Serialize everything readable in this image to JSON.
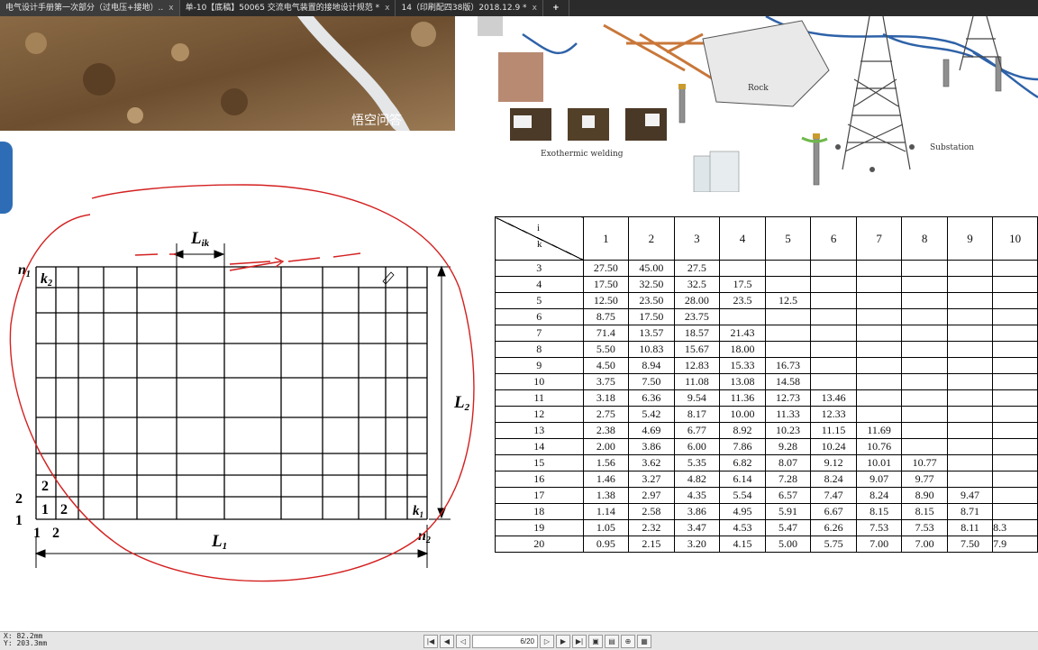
{
  "tabs": [
    {
      "label": "电气设计手册第一次部分（过电压+接地）.."
    },
    {
      "label": "单-10【底稿】50065 交流电气装置的接地设计规范 *"
    },
    {
      "label": "14（印刷配四38版）2018.12.9 *"
    }
  ],
  "tab_close": "x",
  "tab_add": "+",
  "photo": {
    "watermark": "悟空问答"
  },
  "infographic": {
    "label_rock": "Rock",
    "label_welding": "Exothermic welding",
    "label_substation": "Substation"
  },
  "figure": {
    "label_L_ik": "L",
    "label_L_ik_sub": "ik",
    "label_n1": "n",
    "label_n1_sub": "1",
    "label_k2": "k",
    "label_k2_sub": "2",
    "label_L2": "L",
    "label_L2_sub": "2",
    "label_L1": "L",
    "label_L1_sub": "1",
    "label_n2": "n",
    "label_n2_sub": "2",
    "label_k1": "k",
    "label_k1_sub": "1",
    "row_2": "2",
    "row_1": "1",
    "cell_2": "2",
    "cell_1": "1",
    "cell_1b": "1",
    "cell_2b": "2",
    "bottom_1": "1",
    "bottom_2": "2"
  },
  "table": {
    "corner_i": "i",
    "corner_k": "k",
    "columns": [
      "1",
      "2",
      "3",
      "4",
      "5",
      "6",
      "7",
      "8",
      "9",
      "10"
    ],
    "rows": [
      {
        "k": "3",
        "vals": [
          "27.50",
          "45.00",
          "27.5",
          "",
          "",
          "",
          "",
          "",
          "",
          ""
        ]
      },
      {
        "k": "4",
        "vals": [
          "17.50",
          "32.50",
          "32.5",
          "17.5",
          "",
          "",
          "",
          "",
          "",
          ""
        ]
      },
      {
        "k": "5",
        "vals": [
          "12.50",
          "23.50",
          "28.00",
          "23.5",
          "12.5",
          "",
          "",
          "",
          "",
          ""
        ]
      },
      {
        "k": "6",
        "vals": [
          "8.75",
          "17.50",
          "23.75",
          "",
          "",
          "",
          "",
          "",
          "",
          ""
        ]
      },
      {
        "k": "7",
        "vals": [
          "71.4",
          "13.57",
          "18.57",
          "21.43",
          "",
          "",
          "",
          "",
          "",
          ""
        ]
      },
      {
        "k": "8",
        "vals": [
          "5.50",
          "10.83",
          "15.67",
          "18.00",
          "",
          "",
          "",
          "",
          "",
          ""
        ]
      },
      {
        "k": "9",
        "vals": [
          "4.50",
          "8.94",
          "12.83",
          "15.33",
          "16.73",
          "",
          "",
          "",
          "",
          ""
        ]
      },
      {
        "k": "10",
        "vals": [
          "3.75",
          "7.50",
          "11.08",
          "13.08",
          "14.58",
          "",
          "",
          "",
          "",
          ""
        ]
      },
      {
        "k": "11",
        "vals": [
          "3.18",
          "6.36",
          "9.54",
          "11.36",
          "12.73",
          "13.46",
          "",
          "",
          "",
          ""
        ]
      },
      {
        "k": "12",
        "vals": [
          "2.75",
          "5.42",
          "8.17",
          "10.00",
          "11.33",
          "12.33",
          "",
          "",
          "",
          ""
        ]
      },
      {
        "k": "13",
        "vals": [
          "2.38",
          "4.69",
          "6.77",
          "8.92",
          "10.23",
          "11.15",
          "11.69",
          "",
          "",
          ""
        ]
      },
      {
        "k": "14",
        "vals": [
          "2.00",
          "3.86",
          "6.00",
          "7.86",
          "9.28",
          "10.24",
          "10.76",
          "",
          "",
          ""
        ]
      },
      {
        "k": "15",
        "vals": [
          "1.56",
          "3.62",
          "5.35",
          "6.82",
          "8.07",
          "9.12",
          "10.01",
          "10.77",
          "",
          ""
        ]
      },
      {
        "k": "16",
        "vals": [
          "1.46",
          "3.27",
          "4.82",
          "6.14",
          "7.28",
          "8.24",
          "9.07",
          "9.77",
          "",
          ""
        ]
      },
      {
        "k": "17",
        "vals": [
          "1.38",
          "2.97",
          "4.35",
          "5.54",
          "6.57",
          "7.47",
          "8.24",
          "8.90",
          "9.47",
          ""
        ]
      },
      {
        "k": "18",
        "vals": [
          "1.14",
          "2.58",
          "3.86",
          "4.95",
          "5.91",
          "6.67",
          "8.15",
          "8.15",
          "8.71",
          ""
        ]
      },
      {
        "k": "19",
        "vals": [
          "1.05",
          "2.32",
          "3.47",
          "4.53",
          "5.47",
          "6.26",
          "7.53",
          "7.53",
          "8.11",
          "8.3"
        ]
      },
      {
        "k": "20",
        "vals": [
          "0.95",
          "2.15",
          "3.20",
          "4.15",
          "5.00",
          "5.75",
          "7.00",
          "7.00",
          "7.50",
          "7.9"
        ]
      }
    ]
  },
  "status": {
    "x_label": "X:",
    "x_value": "82.2mm",
    "y_label": "Y:",
    "y_value": "203.3mm",
    "page": "6/20"
  }
}
